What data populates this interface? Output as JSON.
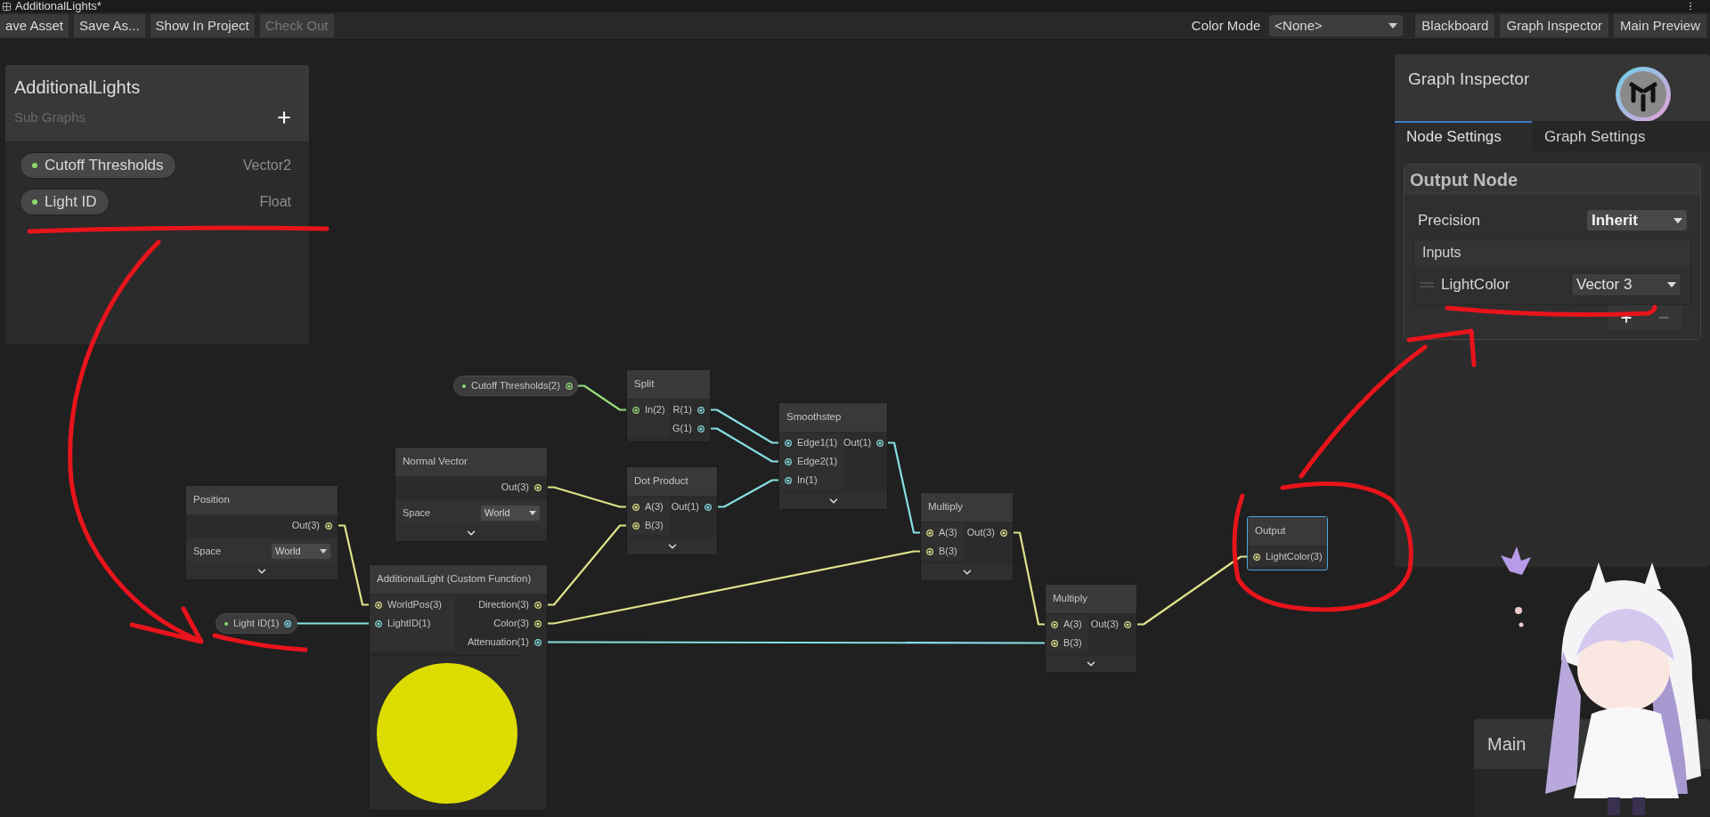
{
  "window": {
    "title": "AdditionalLights*"
  },
  "toolbar": {
    "buttons": [
      {
        "label": "ave Asset",
        "disabled": false
      },
      {
        "label": "Save As...",
        "disabled": false
      },
      {
        "label": "Show In Project",
        "disabled": false
      },
      {
        "label": "Check Out",
        "disabled": true
      }
    ],
    "color_mode": {
      "label": "Color Mode",
      "value": "<None>"
    },
    "toggles": [
      {
        "label": "Blackboard"
      },
      {
        "label": "Graph Inspector"
      },
      {
        "label": "Main Preview"
      }
    ]
  },
  "blackboard": {
    "title": "AdditionalLights",
    "subtitle": "Sub Graphs",
    "properties": [
      {
        "name": "Cutoff Thresholds",
        "type": "Vector2"
      },
      {
        "name": "Light ID",
        "type": "Float"
      }
    ]
  },
  "nodes": [
    {
      "kind": "property",
      "label": "Cutoff Thresholds(2)",
      "outputs": [
        {
          "kind": "vector2"
        }
      ]
    },
    {
      "kind": "node",
      "title": "Split",
      "selected": false,
      "chevron": false,
      "inputs": [
        {
          "label": "In(2)",
          "kind": "vector2"
        }
      ],
      "outputs": [
        {
          "label": "R(1)",
          "kind": "float"
        },
        {
          "label": "G(1)",
          "kind": "float"
        }
      ]
    },
    {
      "kind": "node",
      "title": "Smoothstep",
      "selected": false,
      "chevron": true,
      "inputs": [
        {
          "label": "Edge1(1)",
          "kind": "float"
        },
        {
          "label": "Edge2(1)",
          "kind": "float"
        },
        {
          "label": "In(1)",
          "kind": "float"
        }
      ],
      "outputs": [
        {
          "label": "Out(1)",
          "kind": "float"
        }
      ]
    },
    {
      "kind": "node",
      "title": "Normal Vector",
      "selected": false,
      "chevron": true,
      "outputs": [
        {
          "label": "Out(3)",
          "kind": "vector3"
        }
      ],
      "controls": [
        {
          "label": "Space",
          "value": "World"
        }
      ]
    },
    {
      "kind": "node",
      "title": "Dot Product",
      "selected": false,
      "chevron": true,
      "inputs": [
        {
          "label": "A(3)",
          "kind": "vector3"
        },
        {
          "label": "B(3)",
          "kind": "vector3"
        }
      ],
      "outputs": [
        {
          "label": "Out(1)",
          "kind": "float"
        }
      ]
    },
    {
      "kind": "node",
      "title": "Position",
      "selected": false,
      "chevron": true,
      "outputs": [
        {
          "label": "Out(3)",
          "kind": "vector3"
        }
      ],
      "controls": [
        {
          "label": "Space",
          "value": "World"
        }
      ]
    },
    {
      "kind": "node",
      "title": "Multiply",
      "selected": false,
      "chevron": true,
      "inputs": [
        {
          "label": "A(3)",
          "kind": "vector3"
        },
        {
          "label": "B(3)",
          "kind": "vector3"
        }
      ],
      "outputs": [
        {
          "label": "Out(3)",
          "kind": "vector3"
        }
      ]
    },
    {
      "kind": "node",
      "title": "Output",
      "selected": true,
      "chevron": false,
      "inputs": [
        {
          "label": "LightColor(3)",
          "kind": "vector3"
        }
      ]
    },
    {
      "kind": "property",
      "label": "Light ID(1)",
      "outputs": [
        {
          "kind": "float"
        }
      ]
    },
    {
      "kind": "node",
      "title": "AdditionalLight (Custom Function)",
      "selected": false,
      "chevron": false,
      "preview": true,
      "inputs": [
        {
          "label": "WorldPos(3)",
          "kind": "vector3"
        },
        {
          "label": "LightID(1)",
          "kind": "float"
        }
      ],
      "outputs": [
        {
          "label": "Direction(3)",
          "kind": "vector3"
        },
        {
          "label": "Color(3)",
          "kind": "vector3"
        },
        {
          "label": "Attenuation(1)",
          "kind": "float"
        }
      ]
    },
    {
      "kind": "node",
      "title": "Multiply",
      "selected": false,
      "chevron": true,
      "inputs": [
        {
          "label": "A(3)",
          "kind": "vector3"
        },
        {
          "label": "B(3)",
          "kind": "vector3"
        }
      ],
      "outputs": [
        {
          "label": "Out(3)",
          "kind": "vector3"
        }
      ]
    }
  ],
  "graph_inspector": {
    "title": "Graph Inspector",
    "tabs": [
      {
        "label": "Node Settings",
        "selected": true
      },
      {
        "label": "Graph Settings",
        "selected": false
      }
    ],
    "section": "Output Node",
    "precision": {
      "label": "Precision",
      "value": "Inherit"
    },
    "inputs": {
      "title": "Inputs",
      "rows": [
        {
          "name": "LightColor",
          "type": "Vector 3"
        }
      ]
    }
  },
  "main_preview": {
    "title": "Main"
  }
}
